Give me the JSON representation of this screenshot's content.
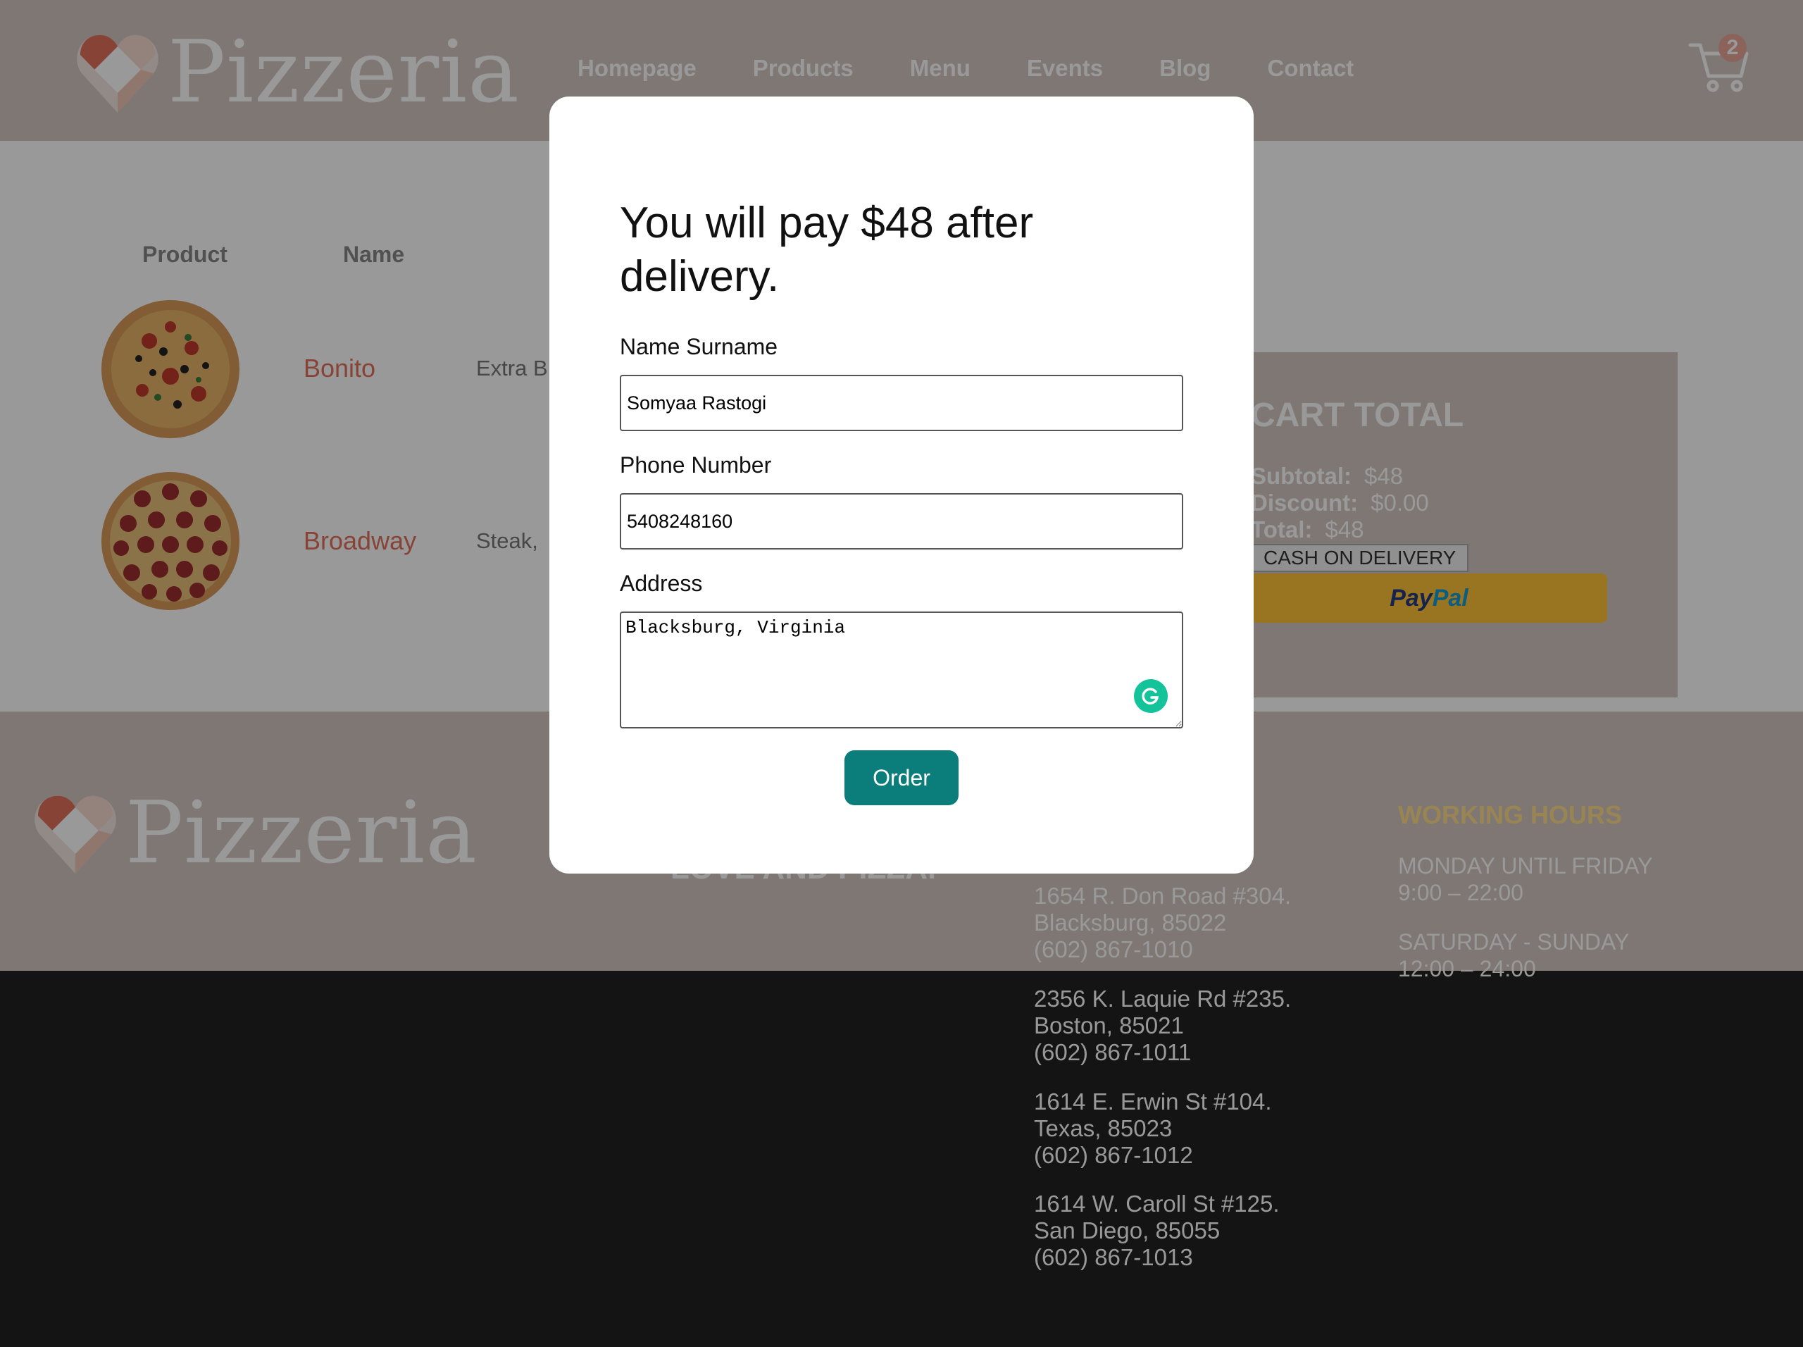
{
  "brand": {
    "name": "Pizzeria"
  },
  "nav": {
    "links": [
      "Homepage",
      "Products",
      "Menu",
      "Events",
      "Blog",
      "Contact"
    ],
    "cart_count": "2"
  },
  "table": {
    "headers": [
      "Product",
      "Name"
    ],
    "rows": [
      {
        "name": "Bonito",
        "desc": "Extra B"
      },
      {
        "name": "Broadway",
        "desc": "Steak,"
      }
    ]
  },
  "cart_total": {
    "title": "CART TOTAL",
    "subtotal_label": "Subtotal:",
    "subtotal_value": "$48",
    "discount_label": "Discount:",
    "discount_value": "$0.00",
    "total_label": "Total:",
    "total_value": "$48",
    "cod_label": "CASH ON DELIVERY",
    "paypal_a": "Pay",
    "paypal_b": "Pal"
  },
  "footer": {
    "tagline": "LOVE AND PIZZA.",
    "addresses": [
      [
        "1654 R. Don Road #304.",
        "Blacksburg, 85022",
        "(602) 867-1010"
      ],
      [
        "2356 K. Laquie Rd #235.",
        "Boston, 85021",
        "(602) 867-1011"
      ],
      [
        "1614 E. Erwin St #104.",
        "Texas, 85023",
        "(602) 867-1012"
      ],
      [
        "1614 W. Caroll St #125.",
        "San Diego, 85055",
        "(602) 867-1013"
      ]
    ],
    "working_hours_title": "WORKING HOURS",
    "hours": [
      [
        "MONDAY UNTIL FRIDAY",
        "9:00 – 22:00"
      ],
      [
        "SATURDAY - SUNDAY",
        "12:00 – 24:00"
      ]
    ]
  },
  "modal": {
    "title": "You will pay $48 after delivery.",
    "name_label": "Name Surname",
    "name_value": "Somyaa Rastogi",
    "phone_label": "Phone Number",
    "phone_value": "5408248160",
    "address_label": "Address",
    "address_value": "Blacksburg, Virginia",
    "order_label": "Order"
  },
  "colors": {
    "accent": "#e2725b",
    "order_button": "#0b7d7b",
    "working_hours": "#ffde8a",
    "paypal": "#ffc439"
  },
  "icons": [
    "heart-logo-icon",
    "cart-icon",
    "grammarly-icon"
  ]
}
